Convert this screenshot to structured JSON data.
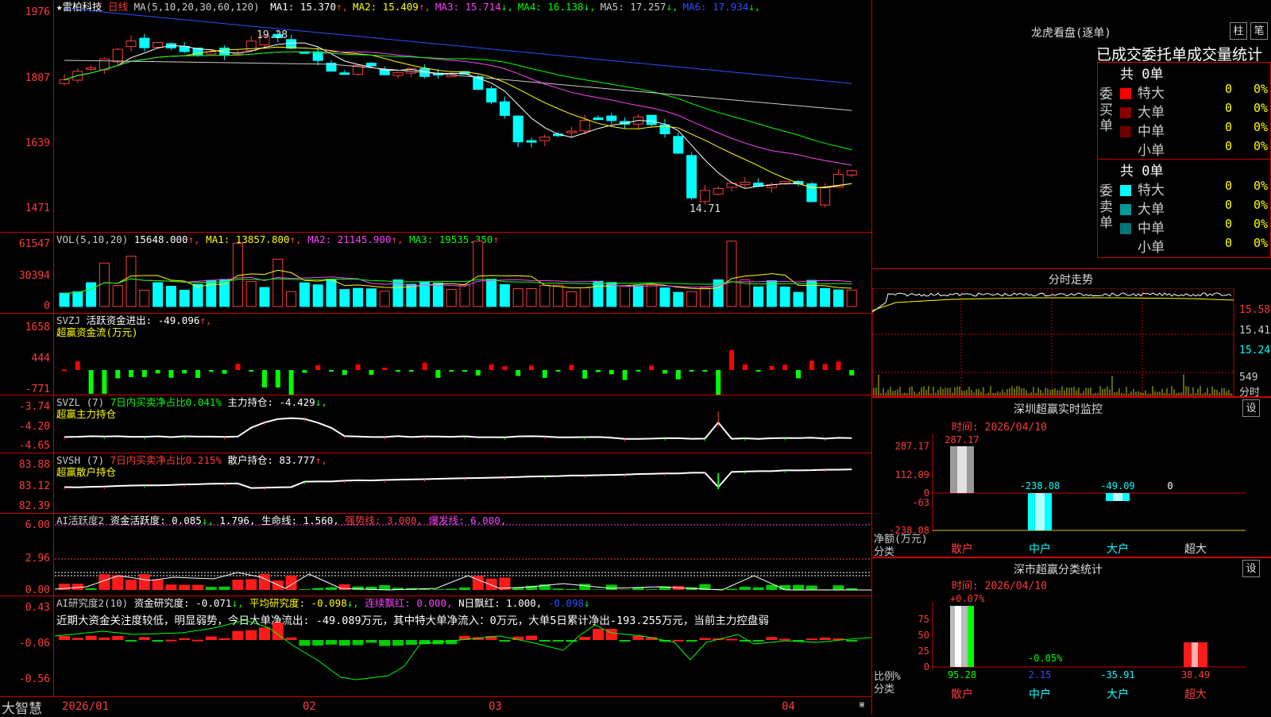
{
  "window": {
    "brand": "大智慧"
  },
  "kline": {
    "stock_name": "★雷柏科技",
    "period": "日线",
    "ma_header": "MA(5,10,20,30,60,120)",
    "ma": [
      {
        "label": "MA1:",
        "value": "15.370",
        "arrow": "↑",
        "color": "#ffffff"
      },
      {
        "label": "MA2:",
        "value": "15.409",
        "arrow": "↑",
        "color": "#ffff00"
      },
      {
        "label": "MA3:",
        "value": "15.714",
        "arrow": "↓",
        "color": "#ff40ff"
      },
      {
        "label": "MA4:",
        "value": "16.138",
        "arrow": "↓",
        "color": "#00ff00"
      },
      {
        "label": "MA5:",
        "value": "17.257",
        "arrow": "↓",
        "color": "#cccccc"
      },
      {
        "label": "MA6:",
        "value": "17.934",
        "arrow": "↓",
        "color": "#2f4fff"
      }
    ],
    "y_ticks": [
      "1976",
      "1807",
      "1639",
      "1471"
    ],
    "high_label": "19.28",
    "low_label": "14.71"
  },
  "vol": {
    "header": "VOL(5,10,20)",
    "value": "15648.000",
    "ma1": "MA1: 13857.800",
    "ma2": "MA2: 21145.900",
    "ma3": "MA3: 19535.350",
    "y_ticks": [
      "61547",
      "30394",
      "0"
    ]
  },
  "svzj": {
    "name": "SVZJ",
    "line1": "活跃资金进出: -49.096",
    "line2": "超赢资金流(万元)",
    "y_ticks": [
      "1658",
      "444",
      "-771"
    ]
  },
  "svzl": {
    "name": "SVZL (7)",
    "label": "7日内买卖净占比0.041%",
    "line1": "主力持仓: -4.429",
    "line2": "超赢主力持仓",
    "y_ticks": [
      "-3.74",
      "-4.20",
      "-4.65"
    ]
  },
  "svsh": {
    "name": "SVSH (7)",
    "label": "7日内买卖净占比0.215%",
    "line1": "散户持仓: 83.777",
    "line2": "超赢散户持仓",
    "y_ticks": [
      "83.88",
      "83.12",
      "82.39"
    ]
  },
  "ai1": {
    "name": "AI活跃度2",
    "a": "资金活跃度: 0.085",
    "b": "1.796,",
    "c": "生命线: 1.560,",
    "d": "强势线: 3.000,",
    "e": "爆发线: 6.000,",
    "y_ticks": [
      "6.00",
      "2.96",
      "0.00"
    ]
  },
  "ai2": {
    "name": "AI研究度2(10)",
    "a": "资金研究度: -0.071",
    "b": "平均研究度: -0.098",
    "c": "连续飘红: 0.000,",
    "d": "N日飘红: 1.000,",
    "e": "-0.098",
    "comment": "近期大资金关注度较低，明显弱势，今日大单净流出: -49.089万元，其中特大单净流入：0万元，大单5日累计净出-193.255万元，当前主力控盘弱",
    "y_ticks": [
      "0.43",
      "-0.06",
      "-0.56"
    ]
  },
  "xaxis": [
    "2026/01",
    "02",
    "03",
    "04"
  ],
  "right": {
    "lhb_title": "龙虎看盘(逐单)",
    "btn_a": "柱",
    "btn_b": "笔",
    "oi_title": "已成交委托单成交量统计",
    "buy_title": "委买单",
    "sell_title": "委卖单",
    "buy_total": "共 0单",
    "sell_total": "共 0单",
    "buy_rows": [
      {
        "label": "特大",
        "v1": "0",
        "v2": "0%",
        "color": "#ff0000"
      },
      {
        "label": "大单",
        "v1": "0",
        "v2": "0%",
        "color": "#8b0000"
      },
      {
        "label": "中单",
        "v1": "0",
        "v2": "0%",
        "color": "#6b0000"
      },
      {
        "label": "小单",
        "v1": "0",
        "v2": "0%",
        "color": "#000000"
      }
    ],
    "sell_rows": [
      {
        "label": "特大",
        "v1": "0",
        "v2": "0%",
        "color": "#00ffff"
      },
      {
        "label": "大单",
        "v1": "0",
        "v2": "0%",
        "color": "#009999"
      },
      {
        "label": "中单",
        "v1": "0",
        "v2": "0%",
        "color": "#007777"
      },
      {
        "label": "小单",
        "v1": "0",
        "v2": "0%",
        "color": "#000000"
      }
    ],
    "intraday_title": "分时走势",
    "intraday_ticks": [
      "15.58",
      "15.41",
      "15.24",
      "549",
      "分时"
    ],
    "monitor_title": "深圳超赢实时监控",
    "monitor_btn": "设",
    "monitor_time": "时间: 2026/04/10",
    "monitor_y": [
      "287.17",
      "112.09",
      "0",
      "-63",
      "-238.08"
    ],
    "monitor_values": {
      "retail": "287.17",
      "mid": "-238.08",
      "large": "-49.09",
      "super": "0"
    },
    "monitor_ylabel": "净额(万元)",
    "monitor_xlabel": "分类",
    "categories": [
      "散户",
      "中户",
      "大户",
      "超大"
    ],
    "stats_title": "深市超赢分类统计",
    "stats_btn": "设",
    "stats_time": "时间: 2026/04/10",
    "stats_y": [
      "75",
      "50",
      "25",
      "0"
    ],
    "stats_top_left": "+0.07%",
    "stats_mid": "-0.05%",
    "stats_values": [
      "95.28",
      "2.15",
      "-35.91",
      "38.49"
    ],
    "stats_ylabel": "比例%",
    "stats_xlabel": "分类"
  }
}
